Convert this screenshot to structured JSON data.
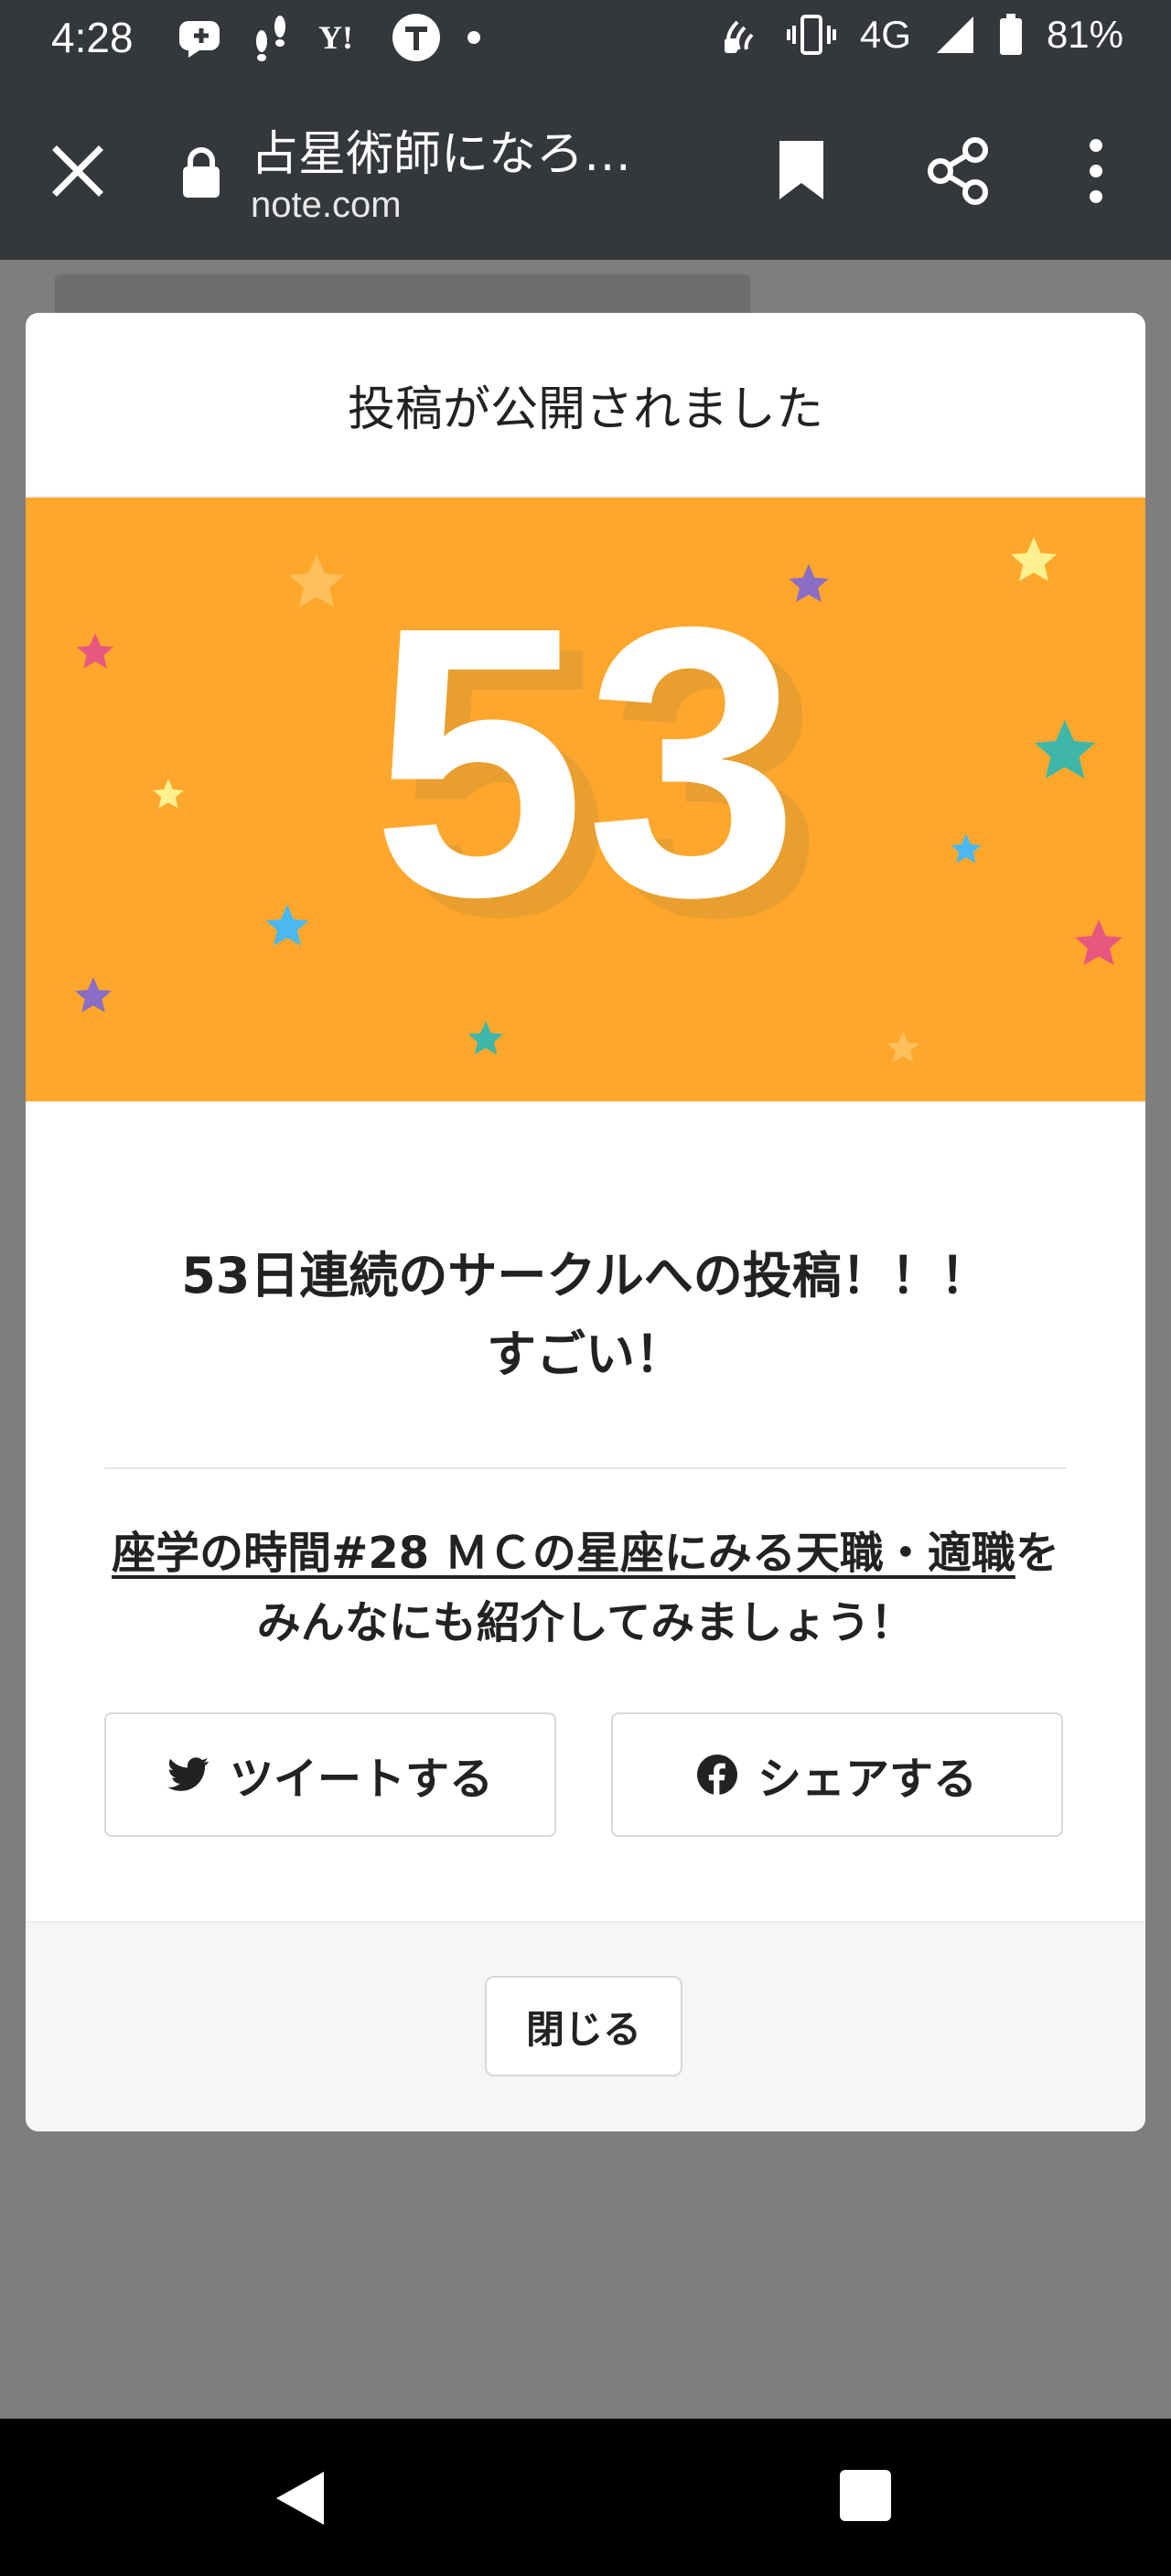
{
  "status_bar": {
    "time": "4:28",
    "network": "4G",
    "battery": "81%",
    "icons": [
      "assistant-icon",
      "footsteps-icon",
      "yahoo-icon",
      "t-icon",
      "dot-icon",
      "nfc-icon",
      "vibrate-icon",
      "signal-icon",
      "battery-icon"
    ]
  },
  "toolbar": {
    "title": "占星術師になろ…",
    "domain": "note.com"
  },
  "modal": {
    "header": "投稿が公開されました",
    "streak_number": "53",
    "message_line1": "53日連続のサークルへの投稿！！！",
    "message_line2": "すごい！",
    "article_link": "座学の時間#28 ＭＣの星座にみる天職・適職",
    "share_prompt_suffix": "を",
    "share_prompt_line2": "みんなにも紹介してみましょう！",
    "tweet_button": "ツイートする",
    "facebook_button": "シェアする",
    "close_button": "閉じる"
  },
  "colors": {
    "hero_bg": "#ffa72c",
    "status_bar": "#34373b",
    "overlay": "#7e7e7e"
  }
}
